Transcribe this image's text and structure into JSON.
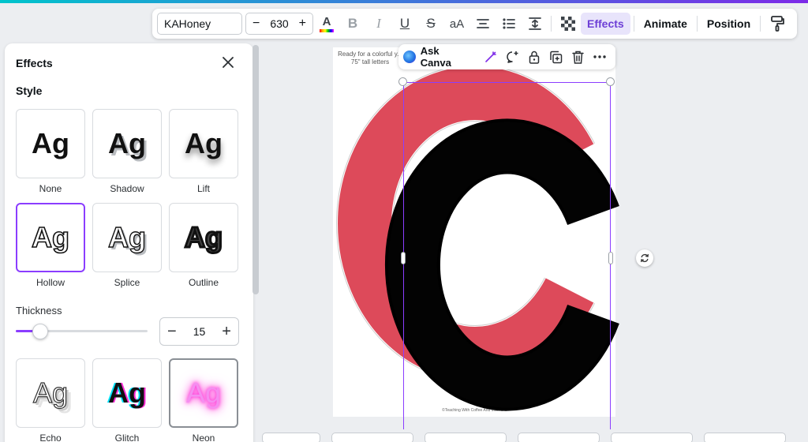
{
  "toolbar": {
    "font_name": "KAHoney",
    "font_size": "630",
    "minus": "−",
    "plus": "+",
    "effects_label": "Effects",
    "animate_label": "Animate",
    "position_label": "Position",
    "case_label": "aA"
  },
  "context_menu": {
    "ask_canva_label": "Ask Canva"
  },
  "effects_panel": {
    "title": "Effects",
    "style_heading": "Style",
    "sample_text": "Ag",
    "styles": [
      {
        "label": "None"
      },
      {
        "label": "Shadow"
      },
      {
        "label": "Lift"
      },
      {
        "label": "Hollow"
      },
      {
        "label": "Splice"
      },
      {
        "label": "Outline"
      },
      {
        "label": "Echo"
      },
      {
        "label": "Glitch"
      },
      {
        "label": "Neon"
      }
    ],
    "selected_style": "Hollow",
    "thickness_label": "Thickness",
    "thickness_value": "15",
    "thickness_fraction": 0.15,
    "stepper_minus": "−",
    "stepper_plus": "+"
  },
  "canvas": {
    "page_note": "Ready for a colorful y... 75\" tall letters",
    "footer_text": "©Teaching With Coffee And Mascara",
    "letter": "C",
    "letter_fill": "#dd4a5a"
  },
  "colors": {
    "accent": "#8b3dff",
    "letter_red": "#dd4a5a"
  }
}
